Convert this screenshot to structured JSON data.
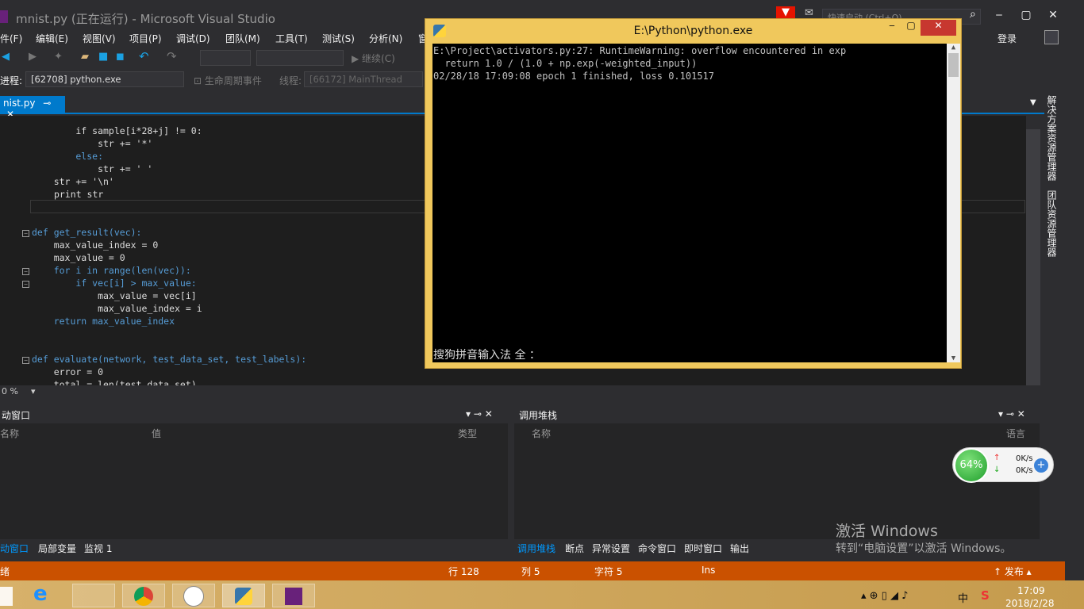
{
  "vs": {
    "title": "mnist.py (正在运行) - Microsoft Visual Studio",
    "quick_launch": "快速启动 (Ctrl+Q)",
    "login": "登录",
    "menu": [
      "件(F)",
      "编辑(E)",
      "视图(V)",
      "项目(P)",
      "调试(D)",
      "团队(M)",
      "工具(T)",
      "测试(S)",
      "分析(N)",
      "窗"
    ],
    "continue_label": "继续(C)",
    "process_label": "进程:",
    "process_value": "[62708] python.exe",
    "lifecycle_label": "生命周期事件",
    "thread_label": "线程:",
    "thread_value": "[66172] MainThread",
    "tab_name": "nist.py",
    "zoom": "0 %",
    "side_tabs": [
      "解决方案资源管理器",
      "团队资源管理器"
    ]
  },
  "code": [
    {
      "kind": "plain",
      "text": "        if sample[i*28+j] != 0:"
    },
    {
      "kind": "plain",
      "text": "            str += '*'"
    },
    {
      "kind": "plain",
      "text": "        else:"
    },
    {
      "kind": "plain",
      "text": "            str += ' '"
    },
    {
      "kind": "plain",
      "text": "    str += '\\n'"
    },
    {
      "kind": "plain",
      "text": "print str"
    },
    {
      "kind": "plain",
      "text": ""
    },
    {
      "kind": "plain",
      "text": ""
    },
    {
      "kind": "plain",
      "text": "def get_result(vec):"
    },
    {
      "kind": "plain",
      "text": "    max_value_index = 0"
    },
    {
      "kind": "plain",
      "text": "    max_value = 0"
    },
    {
      "kind": "plain",
      "text": "    for i in range(len(vec)):"
    },
    {
      "kind": "plain",
      "text": "        if vec[i] > max_value:"
    },
    {
      "kind": "plain",
      "text": "            max_value = vec[i]"
    },
    {
      "kind": "plain",
      "text": "            max_value_index = i"
    },
    {
      "kind": "plain",
      "text": "    return max_value_index"
    },
    {
      "kind": "plain",
      "text": ""
    },
    {
      "kind": "plain",
      "text": ""
    },
    {
      "kind": "plain",
      "text": "def evaluate(network, test_data_set, test_labels):"
    },
    {
      "kind": "plain",
      "text": "    error = 0"
    },
    {
      "kind": "plain",
      "text": "    total = len(test_data_set)"
    }
  ],
  "panes": {
    "left": {
      "title": "动窗口",
      "col_name": "名称",
      "col_value": "值",
      "col_type": "类型",
      "tabs": [
        "动窗口",
        "局部变量",
        "监视 1"
      ]
    },
    "right": {
      "title": "调用堆栈",
      "col_name": "名称",
      "col_lang": "语言",
      "tabs": [
        "调用堆栈",
        "断点",
        "异常设置",
        "命令窗口",
        "即时窗口",
        "输出"
      ]
    }
  },
  "status": {
    "left": "绪",
    "row": "行 128",
    "col": "列 5",
    "char": "字符 5",
    "ins": "Ins",
    "publish": "↑ 发布 ▴"
  },
  "console": {
    "title": "E:\\Python\\python.exe",
    "lines": [
      "E:\\Project\\activators.py:27: RuntimeWarning: overflow encountered in exp",
      "  return 1.0 / (1.0 + np.exp(-weighted_input))",
      "02/28/18 17:09:08 epoch 1 finished, loss 0.101517"
    ],
    "ime": "搜狗拼音输入法 全 ："
  },
  "net_widget": {
    "percent": "64%",
    "up": "0K/s",
    "down": "0K/s"
  },
  "watermark": {
    "line1": "激活 Windows",
    "line2": "转到“电脑设置”以激活 Windows。"
  },
  "taskbar": {
    "time": "17:09",
    "date": "2018/2/28",
    "ime": "中"
  }
}
